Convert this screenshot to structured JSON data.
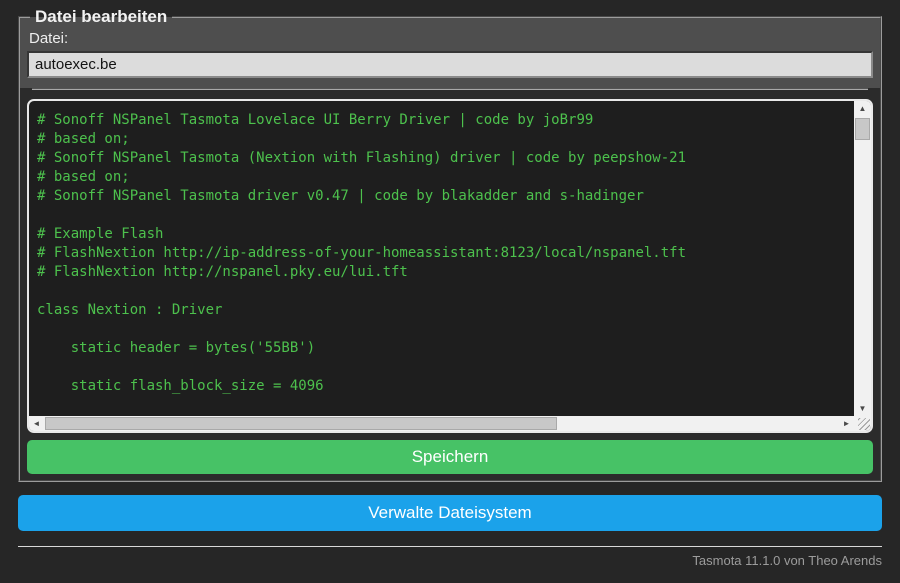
{
  "editor_panel": {
    "legend": "Datei bearbeiten",
    "file_label": "Datei:",
    "filename": "autoexec.be",
    "code_lines": [
      "# Sonoff NSPanel Tasmota Lovelace UI Berry Driver | code by joBr99",
      "# based on;",
      "# Sonoff NSPanel Tasmota (Nextion with Flashing) driver | code by peepshow-21",
      "# based on;",
      "# Sonoff NSPanel Tasmota driver v0.47 | code by blakadder and s-hadinger",
      "",
      "# Example Flash",
      "# FlashNextion http://ip-address-of-your-homeassistant:8123/local/nspanel.tft",
      "# FlashNextion http://nspanel.pky.eu/lui.tft",
      "",
      "class Nextion : Driver",
      "",
      "    static header = bytes('55BB')",
      "",
      "    static flash_block_size = 4096"
    ],
    "save_button_label": "Speichern"
  },
  "filesystem_button_label": "Verwalte Dateisystem",
  "footer": {
    "credit": "Tasmota 11.1.0 von Theo Arends"
  },
  "icons": {
    "scroll_up": "▲",
    "scroll_down": "▼",
    "scroll_left": "◄",
    "scroll_right": "►"
  },
  "colors": {
    "page_bg": "#262626",
    "panel_top_bg": "#4e4e4e",
    "panel_bottom_bg": "#2b2b2b",
    "panel_border": "#9c9c9c",
    "filename_input_bg": "#dcdcdc",
    "code_bg": "#1e1e1e",
    "code_text": "#4dc14d",
    "code_frame_border": "#e9e9e9",
    "scrollbar_track": "#f1f1f1",
    "scrollbar_thumb": "#c8c8c8",
    "save_button_bg": "#47c266",
    "filesystem_button_bg": "#1ba2ea",
    "button_text": "#ffffff",
    "footer_text": "#9c9c9c"
  }
}
